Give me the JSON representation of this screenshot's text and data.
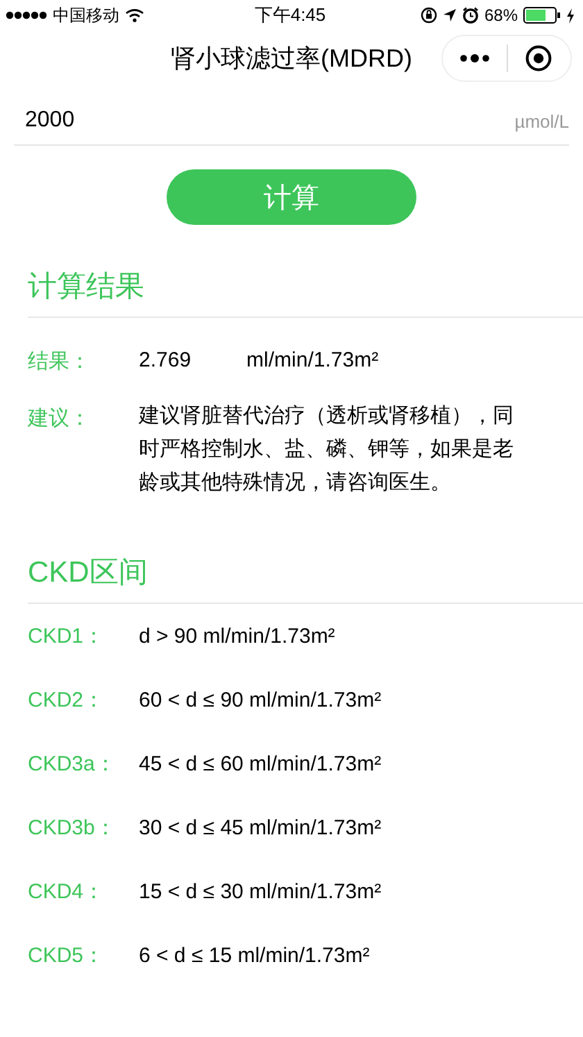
{
  "status_bar": {
    "carrier": "中国移动",
    "time": "下午4:45",
    "battery_percent": "68%"
  },
  "nav_bar": {
    "title": "肾小球滤过率(MDRD)"
  },
  "input": {
    "value": "2000",
    "unit": "µmol/L"
  },
  "calculate_button": "计算",
  "result_section": {
    "heading": "计算结果",
    "rows": [
      {
        "label": "结果：",
        "value": "2.769",
        "unit": "ml/min/1.73m²"
      },
      {
        "label": "建议：",
        "value": "建议肾脏替代治疗（透析或肾移植），同时严格控制水、盐、磷、钾等，如果是老龄或其他特殊情况，请咨询医生。"
      }
    ]
  },
  "ckd_section": {
    "heading": "CKD区间",
    "rows": [
      {
        "label": "CKD1：",
        "range": "d > 90 ml/min/1.73m²"
      },
      {
        "label": "CKD2：",
        "range": "60 < d ≤ 90 ml/min/1.73m²"
      },
      {
        "label": "CKD3a：",
        "range": "45 < d ≤ 60 ml/min/1.73m²"
      },
      {
        "label": "CKD3b：",
        "range": "30 < d ≤ 45 ml/min/1.73m²"
      },
      {
        "label": "CKD4：",
        "range": "15 < d ≤ 30 ml/min/1.73m²"
      },
      {
        "label": "CKD5：",
        "range": "6 < d ≤ 15 ml/min/1.73m²"
      }
    ]
  }
}
